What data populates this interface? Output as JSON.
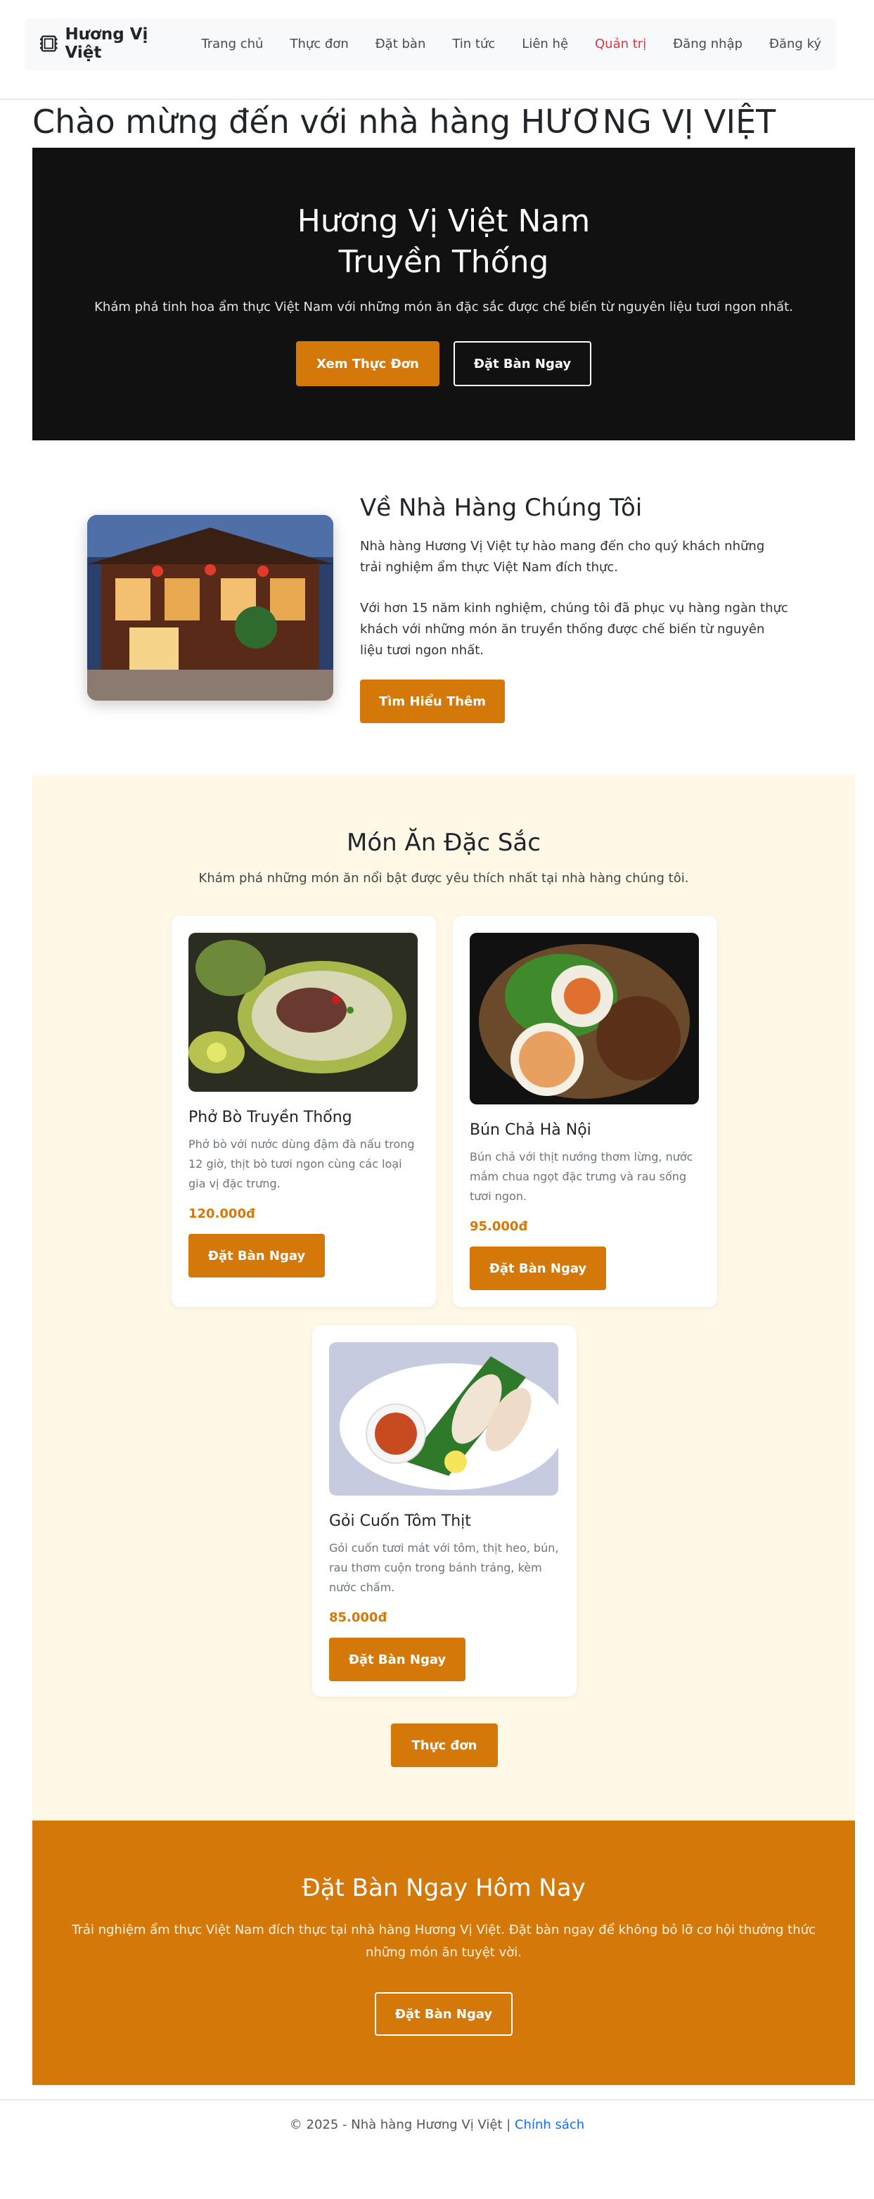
{
  "nav": {
    "brand": "Hương Vị Việt",
    "items": [
      "Trang chủ",
      "Thực đơn",
      "Đặt bàn",
      "Tin tức",
      "Liên hệ",
      "Quản trị",
      "Đăng nhập",
      "Đăng ký"
    ],
    "highlight_color": "#dc3545"
  },
  "welcome": "Chào mừng đến với nhà hàng HƯƠNG VỊ VIỆT",
  "hero": {
    "title_line1": "Hương Vị Việt Nam",
    "title_line2": "Truyền Thống",
    "subtitle": "Khám phá tinh hoa ẩm thực Việt Nam với những món ăn đặc sắc được chế biến từ nguyên liệu tươi ngon nhất.",
    "btn_menu": "Xem Thực Đơn",
    "btn_book": "Đặt Bàn Ngay"
  },
  "about": {
    "title": "Về Nhà Hàng Chúng Tôi",
    "p1": "Nhà hàng Hương Vị Việt tự hào mang đến cho quý khách những trải nghiệm ẩm thực Việt Nam đích thực.",
    "p2": "Với hơn 15 năm kinh nghiệm, chúng tôi đã phục vụ hàng ngàn thực khách với những món ăn truyền thống được chế biến từ nguyên liệu tươi ngon nhất.",
    "btn": "Tìm Hiểu Thêm"
  },
  "featured": {
    "title": "Món Ăn Đặc Sắc",
    "subtitle": "Khám phá những món ăn nổi bật được yêu thích nhất tại nhà hàng chúng tôi.",
    "dishes": [
      {
        "name": "Phở Bò Truyền Thống",
        "desc": "Phở bò với nước dùng đậm đà nấu trong 12 giờ, thịt bò tươi ngon cùng các loại gia vị đặc trưng.",
        "price": "120.000đ",
        "btn": "Đặt Bàn Ngay"
      },
      {
        "name": "Bún Chả Hà Nội",
        "desc": "Bún chả với thịt nướng thơm lừng, nước mắm chua ngọt đặc trưng và rau sống tươi ngon.",
        "price": "95.000đ",
        "btn": "Đặt Bàn Ngay"
      },
      {
        "name": "Gỏi Cuốn Tôm Thịt",
        "desc": "Gỏi cuốn tươi mát với tôm, thịt heo, bún, rau thơm cuộn trong bánh tráng, kèm nước chấm.",
        "price": "85.000đ",
        "btn": "Đặt Bàn Ngay"
      }
    ],
    "menu_btn": "Thực đơn"
  },
  "cta": {
    "title": "Đặt Bàn Ngay Hôm Nay",
    "text": "Trải nghiệm ẩm thực Việt Nam đích thực tại nhà hàng Hương Vị Việt. Đặt bàn ngay để không bỏ lỡ cơ hội thưởng thức những món ăn tuyệt vời.",
    "btn": "Đặt Bàn Ngay"
  },
  "footer": {
    "text": "© 2025 - Nhà hàng Hương Vị Việt | ",
    "link": "Chính sách"
  },
  "colors": {
    "accent": "#d4780a",
    "hero_bg": "#111111",
    "featured_bg": "#fff8e7",
    "link": "#0d6efd"
  }
}
